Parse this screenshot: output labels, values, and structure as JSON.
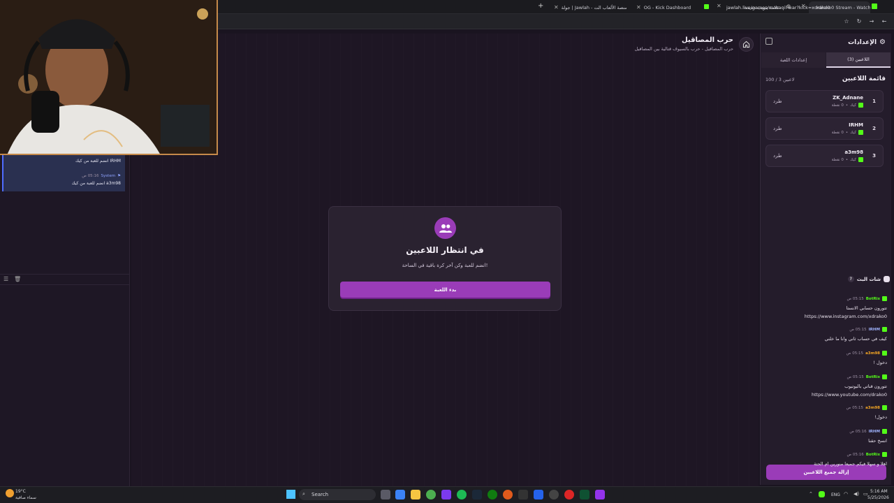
{
  "browser": {
    "tabs": [
      {
        "label": "xdrako0 Stream - Watch Li"
      },
      {
        "label": "علامة تبويب جديدة"
      },
      {
        "label": "OG - Kick Dashboard"
      },
      {
        "label": "جولة | Jawlah - منصة الألعاب الت"
      }
    ],
    "url": "jawlah.live/games/masaqil-war?kick=xdrako0"
  },
  "header": {
    "title": "حرب المصاقيل",
    "subtitle": "حرب المصاقيل - حرب بالسيوف قتالية بين المصاقيل"
  },
  "settings": {
    "title": "الإعدادات",
    "tabs": {
      "players": "اللاعبين (3)",
      "game": "إعدادات اللعبة"
    },
    "players_heading": "قائمة اللاعبين",
    "players_count": "100 / 3 لاعبين",
    "players": [
      {
        "num": "1",
        "name": "ZK_Adnane",
        "platform": "كيك",
        "points": "0 نقطة",
        "kick_label": "طرد"
      },
      {
        "num": "2",
        "name": "IRHM",
        "platform": "كيك",
        "points": "0 نقطة",
        "kick_label": "طرد"
      },
      {
        "num": "3",
        "name": "a3m98",
        "platform": "كيك",
        "points": "0 نقطة",
        "kick_label": "طرد"
      }
    ],
    "remove_all": "إزالة جميع اللاعبين"
  },
  "modal": {
    "title": "في انتظار اللاعبين",
    "subtitle": "انضم للعبة وكن آخر كرة باقية في الساحة!",
    "start": "بدء اللعبة"
  },
  "chat": {
    "system_messages": [
      {
        "user": "IRHM",
        "time": "",
        "text": "انضم للعبة من كيك"
      },
      {
        "user": "System",
        "time": "05:16 ص",
        "text": "a3m98 انضم للعبة من كيك"
      }
    ],
    "title": "شات البث",
    "messages": [
      {
        "user": "BotRix",
        "time": "05:15 ص",
        "color": "#53fc18",
        "lines": [
          "تتورون حسابي الانستا",
          "https://www.instagram.com/xdrako0"
        ]
      },
      {
        "user": "IRHM",
        "time": "05:15 ص",
        "color": "#9fb3ff",
        "lines": [
          "كيف في حساب ثاني وانا ما خلني"
        ]
      },
      {
        "user": "a3m98",
        "time": "05:15 ص",
        "color": "#f5a623",
        "lines": [
          "دخول !"
        ]
      },
      {
        "user": "BotRix",
        "time": "05:15 ص",
        "color": "#53fc18",
        "lines": [
          "تتورون قناتي باليوتيوب",
          "https://www.youtube.com/drako0"
        ]
      },
      {
        "user": "a3m98",
        "time": "05:15 ص",
        "color": "#f5a623",
        "lines": [
          "دخول!"
        ]
      },
      {
        "user": "IRHM",
        "time": "05:16 ص",
        "color": "#9fb3ff",
        "lines": [
          "انسخ حقنا"
        ]
      },
      {
        "user": "BotRix",
        "time": "05:16 ص",
        "color": "#53fc18",
        "lines": [
          "اهلا و سهلا فيكم جميعا منورين ام الحتة"
        ]
      }
    ]
  },
  "taskbar": {
    "weather_temp": "19°C",
    "weather_desc": "سماء صافية",
    "search": "Search",
    "lang": "ENG",
    "time": "5:16 AM",
    "date": "5/25/2026"
  },
  "colors": {
    "accent": "#9a3cb8",
    "kick_green": "#53fc18",
    "background": "#1a1420"
  }
}
